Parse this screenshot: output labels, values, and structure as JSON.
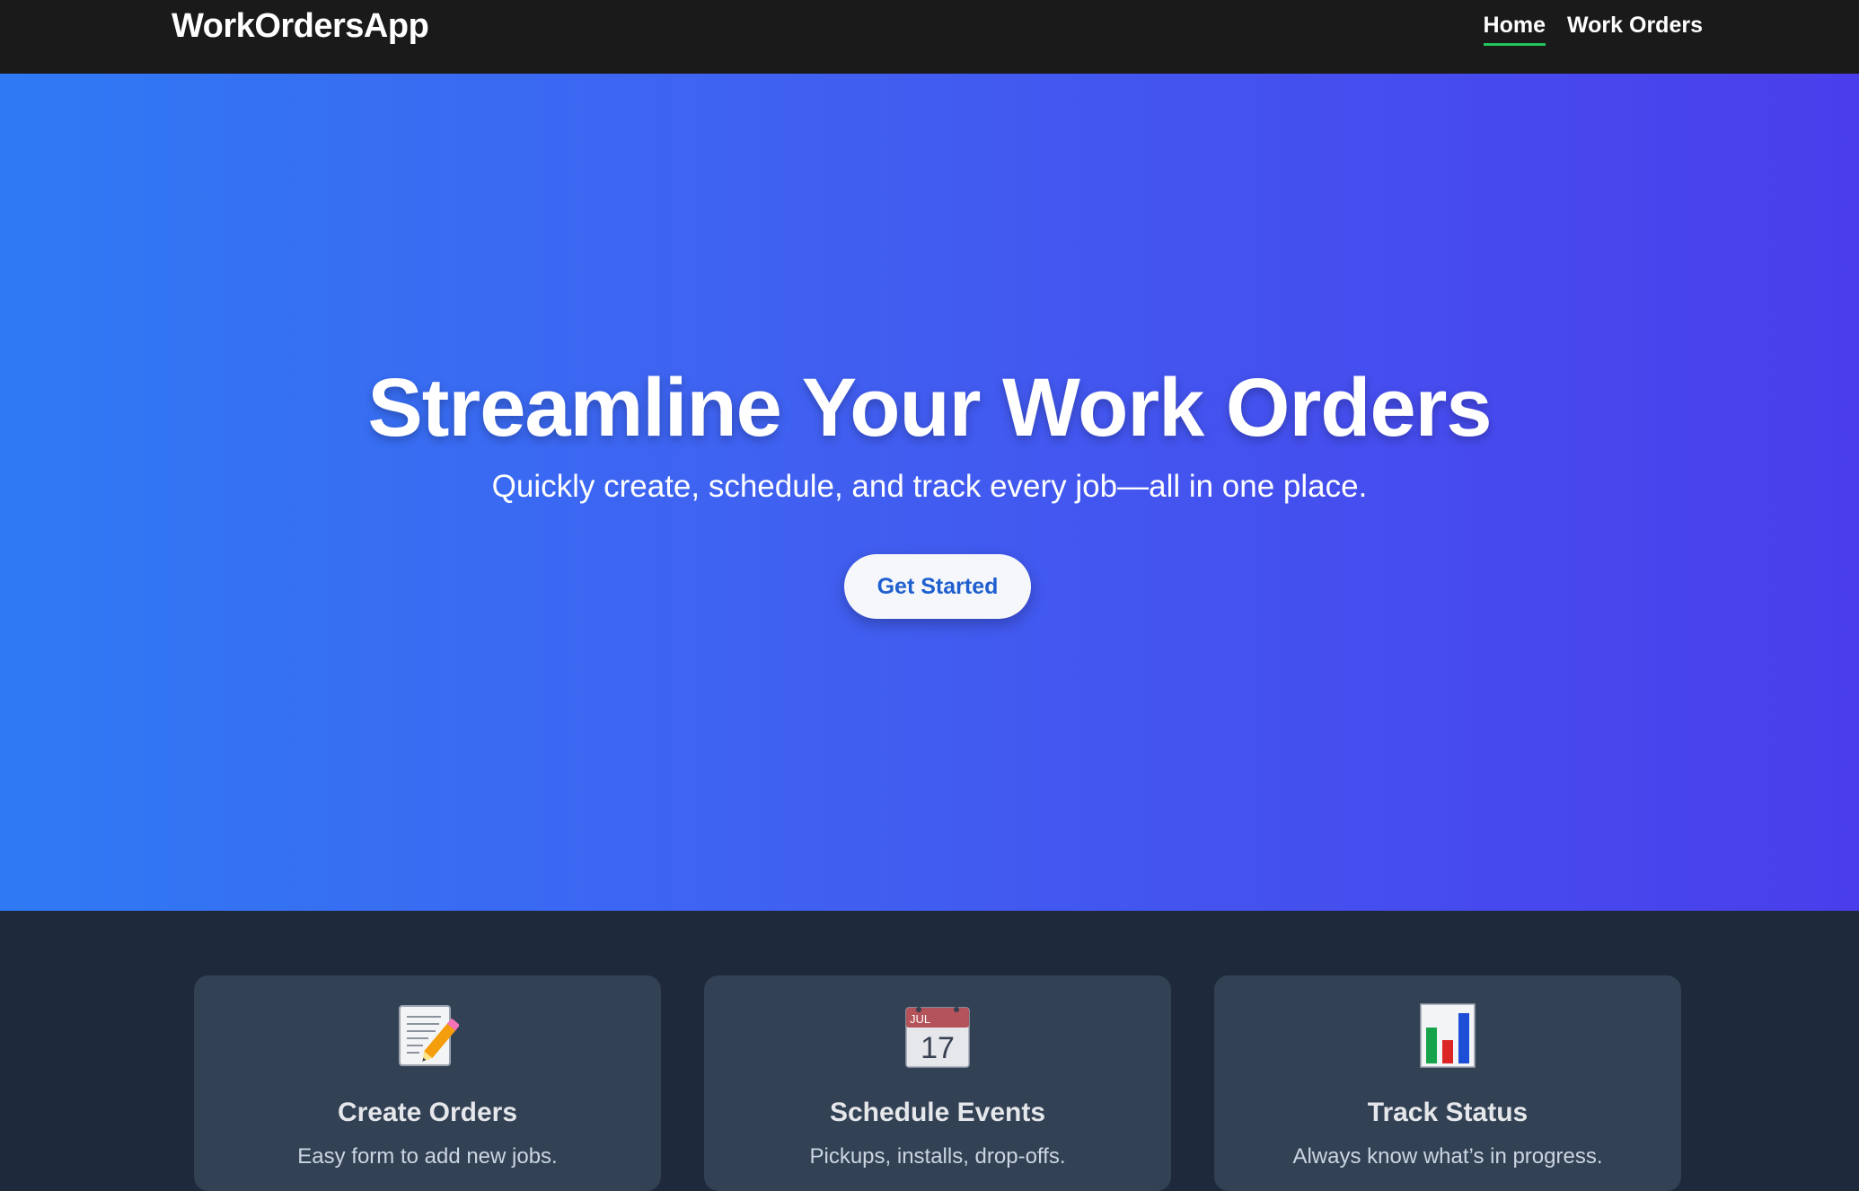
{
  "nav": {
    "brand": "WorkOrdersApp",
    "links": [
      {
        "label": "Home",
        "active": true
      },
      {
        "label": "Work Orders",
        "active": false
      }
    ]
  },
  "hero": {
    "title": "Streamline Your Work Orders",
    "subtitle": "Quickly create, schedule, and track every job—all in one place.",
    "cta_label": "Get Started"
  },
  "features": [
    {
      "icon": "memo-pencil-icon",
      "title": "Create Orders",
      "description": "Easy form to add new jobs."
    },
    {
      "icon": "calendar-icon",
      "title": "Schedule Events",
      "description": "Pickups, installs, drop-offs.",
      "calendar_month": "JUL",
      "calendar_day": "17"
    },
    {
      "icon": "bar-chart-icon",
      "title": "Track Status",
      "description": "Always know what’s in progress."
    }
  ],
  "colors": {
    "navbar_bg": "#1a1a1a",
    "active_underline": "#22c55e",
    "hero_gradient_start": "#2f7af4",
    "hero_gradient_end": "#4a3eec",
    "features_bg": "#1e293b",
    "card_bg": "#334155",
    "cta_text": "#1f5fcf"
  }
}
